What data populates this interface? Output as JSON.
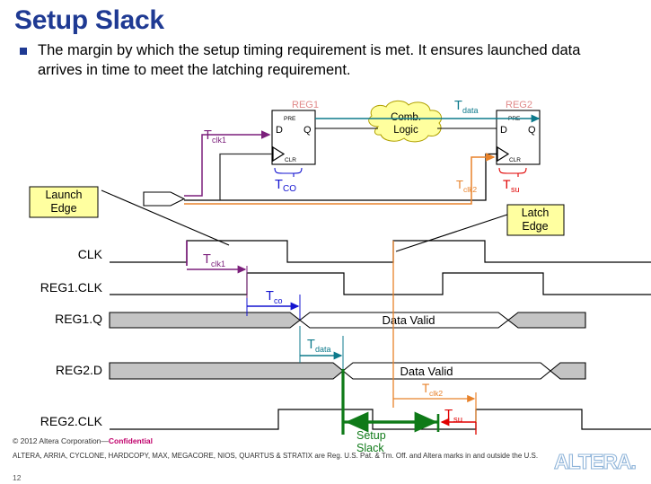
{
  "slide": {
    "title": "Setup Slack",
    "bullet": "The margin by which the setup timing requirement is met.  It ensures launched data arrives in time to meet the latching requirement.",
    "page_number": "12"
  },
  "footer": {
    "copyright_prefix": "© 2012 Altera Corporation—",
    "confidential": "Confidential",
    "legal": "ALTERA, ARRIA, CYCLONE, HARDCOPY, MAX, MEGACORE, NIOS, QUARTUS & STRATIX are Reg. U.S. Pat. & Tm. Off. and Altera marks in and outside the U.S.",
    "logo_text": "ALTERA."
  },
  "schematic": {
    "reg1_label": "REG1",
    "reg2_label": "REG2",
    "pre_label": "PRE",
    "clr_label": "CLR",
    "d_label": "D",
    "q_label": "Q",
    "cloud_line1": "Comb.",
    "cloud_line2": "Logic",
    "t_clk1": "T",
    "t_clk1_sub": "clk1",
    "t_co": "T",
    "t_co_sub": "CO",
    "t_data": "T",
    "t_data_sub": "data",
    "t_clk2": "T",
    "t_clk2_sub": "clk2",
    "t_su": "T",
    "t_su_sub": "su"
  },
  "callouts": {
    "launch_edge_line1": "Launch",
    "launch_edge_line2": "Edge",
    "latch_edge_line1": "Latch",
    "latch_edge_line2": "Edge"
  },
  "waveform": {
    "rows": [
      {
        "name": "CLK",
        "label": "CLK"
      },
      {
        "name": "REG1.CLK",
        "label": "REG1.CLK"
      },
      {
        "name": "REG1.Q",
        "label": "REG1.Q"
      },
      {
        "name": "REG2.D",
        "label": "REG2.D"
      },
      {
        "name": "REG2.CLK",
        "label": "REG2.CLK"
      }
    ],
    "data_valid_1": "Data Valid",
    "data_valid_2": "Data Valid",
    "slack_line1": "Setup",
    "slack_line2": "Slack",
    "t_clk1": "T",
    "t_clk1_sub": "clk1",
    "t_co": "T",
    "t_co_sub": "co",
    "t_data": "T",
    "t_data_sub": "data",
    "t_clk2": "T",
    "t_clk2_sub": "clk2",
    "t_su": "T",
    "t_su_sub": "su"
  },
  "colors": {
    "title_blue": "#1f3a93",
    "purple": "#7b1f7b",
    "blue": "#1414d0",
    "teal": "#0d7a8c",
    "orange": "#e8822a",
    "red": "#e00000",
    "green": "#0f7a18",
    "callout_yellow": "#ffffa0",
    "bus_gray": "#c4c4c4",
    "reg_label_pink": "#e08a8a",
    "cloud_yellow": "#ffff9e"
  }
}
